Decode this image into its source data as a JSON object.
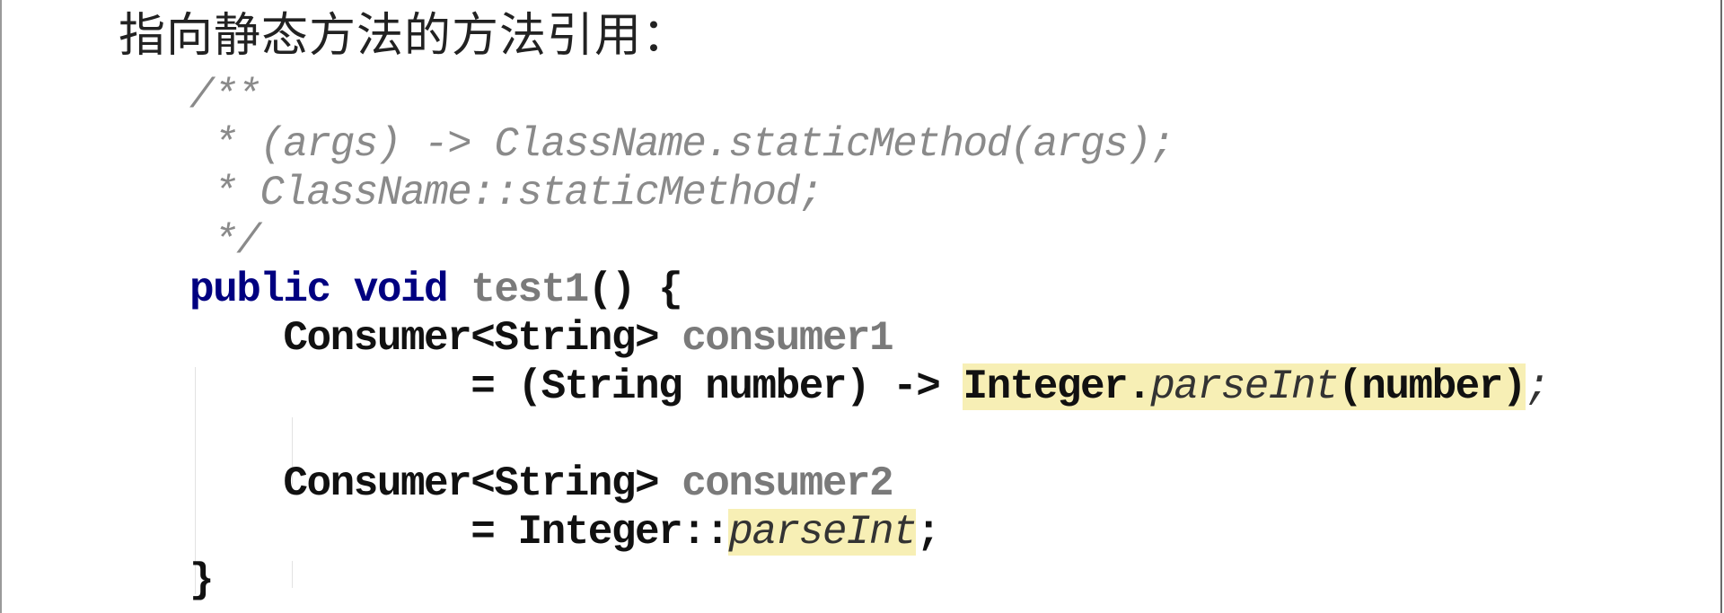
{
  "title": "指向静态方法的方法引用：",
  "code": {
    "comment": [
      "/**",
      " * (args) -> ClassName.staticMethod(args);",
      " * ClassName::staticMethod;",
      " */"
    ],
    "l5": {
      "kw": "public void ",
      "name": "test1",
      "rest": "() {"
    },
    "l6": {
      "indent": "    ",
      "type": "Consumer<String> ",
      "var": "consumer1"
    },
    "l7": {
      "indent": "            ",
      "pre": "= (String number) -> ",
      "cls": "Integer",
      "dot": ".",
      "method": "parseInt",
      "args": "(number)",
      "semi": ";"
    },
    "l9": {
      "indent": "    ",
      "type": "Consumer<String> ",
      "var": "consumer2"
    },
    "l10": {
      "indent": "            ",
      "pre": "= Integer::",
      "method": "parseInt",
      "semi": ";"
    },
    "l11": "}"
  },
  "colors": {
    "highlight": "#f7efb5",
    "keyword": "#000080",
    "comment": "#8a8a8a"
  }
}
